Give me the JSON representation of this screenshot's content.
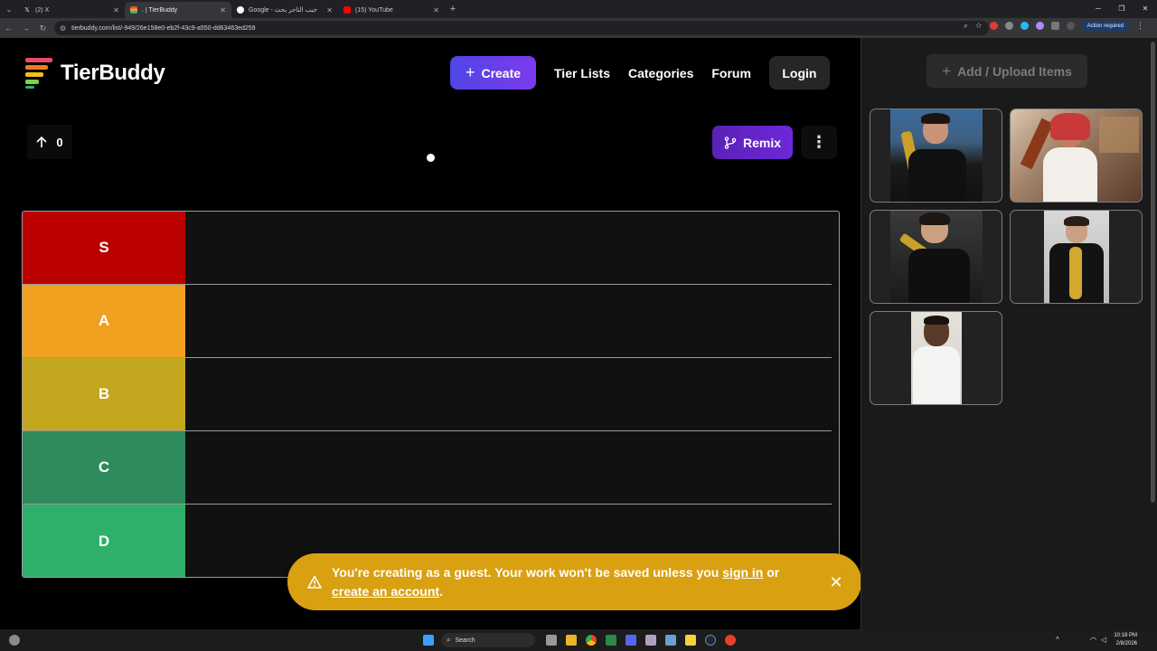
{
  "browser": {
    "tabs": [
      {
        "title": "(2) X",
        "favicon": "x-icon",
        "active": false
      },
      {
        "title": ". | TierBuddy",
        "favicon": "tierbuddy-icon",
        "active": true
      },
      {
        "title": "Google - جيب التاجر بحث",
        "favicon": "google-icon",
        "active": false
      },
      {
        "title": "(15) YouTube",
        "favicon": "youtube-icon",
        "active": false
      }
    ],
    "url": "tierbuddy.com/list/-949/26e158e0-eb2f-43c9-a550-dd63463ed259",
    "action_required": "Action required"
  },
  "site": {
    "brand": "TierBuddy",
    "nav": {
      "create": "Create",
      "tier_lists": "Tier Lists",
      "categories": "Categories",
      "forum": "Forum",
      "login": "Login"
    },
    "vote_count": "0",
    "remix": "Remix",
    "more": "⋮"
  },
  "tiers": [
    {
      "label": "S",
      "color": "#bb0000"
    },
    {
      "label": "A",
      "color": "#f0a01f"
    },
    {
      "label": "B",
      "color": "#c4a61f"
    },
    {
      "label": "C",
      "color": "#2e8b5c"
    },
    {
      "label": "D",
      "color": "#2eb06a"
    }
  ],
  "toast": {
    "text_before": "You're creating as a guest. Your work won't be saved unless you ",
    "sign_in": "sign in",
    "text_middle": " or ",
    "create_account": "create an account",
    "text_after": "."
  },
  "sidebar": {
    "upload_label": "Add / Upload Items",
    "items": [
      {
        "name": "item-1"
      },
      {
        "name": "item-2"
      },
      {
        "name": "item-3"
      },
      {
        "name": "item-4"
      },
      {
        "name": "item-5"
      }
    ]
  },
  "taskbar": {
    "search": "Search",
    "time": "10:18 PM",
    "date": "2/8/2026"
  }
}
